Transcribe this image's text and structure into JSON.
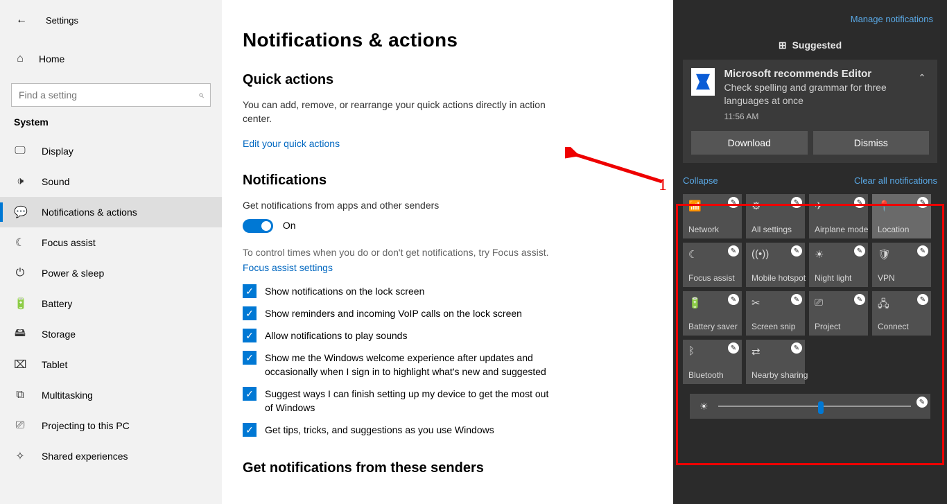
{
  "app": {
    "title": "Settings",
    "home": "Home",
    "find_placeholder": "Find a setting",
    "group": "System"
  },
  "nav": [
    {
      "icon": "🖵",
      "label": "Display"
    },
    {
      "icon": "🕩",
      "label": "Sound"
    },
    {
      "icon": "💬",
      "label": "Notifications & actions"
    },
    {
      "icon": "☾",
      "label": "Focus assist"
    },
    {
      "icon": "⏻",
      "label": "Power & sleep"
    },
    {
      "icon": "🔋",
      "label": "Battery"
    },
    {
      "icon": "🖴",
      "label": "Storage"
    },
    {
      "icon": "⌧",
      "label": "Tablet"
    },
    {
      "icon": "⧉",
      "label": "Multitasking"
    },
    {
      "icon": "⎚",
      "label": "Projecting to this PC"
    },
    {
      "icon": "✧",
      "label": "Shared experiences"
    }
  ],
  "page": {
    "title": "Notifications & actions",
    "qa_head": "Quick actions",
    "qa_desc": "You can add, remove, or rearrange your quick actions directly in action center.",
    "qa_link": "Edit your quick actions",
    "notif_head": "Notifications",
    "notif_desc": "Get notifications from apps and other senders",
    "toggle_label": "On",
    "focus_hint": "To control times when you do or don't get notifications, try Focus assist.",
    "focus_link": "Focus assist settings",
    "checks": [
      "Show notifications on the lock screen",
      "Show reminders and incoming VoIP calls on the lock screen",
      "Allow notifications to play sounds",
      "Show me the Windows welcome experience after updates and occasionally when I sign in to highlight what's new and suggested",
      "Suggest ways I can finish setting up my device to get the most out of Windows",
      "Get tips, tricks, and suggestions as you use Windows"
    ],
    "senders_head": "Get notifications from these senders"
  },
  "ac": {
    "manage": "Manage notifications",
    "suggested": "Suggested",
    "card": {
      "title": "Microsoft recommends Editor",
      "sub": "Check spelling and grammar for three languages at once",
      "time": "11:56 AM",
      "download": "Download",
      "dismiss": "Dismiss"
    },
    "collapse": "Collapse",
    "clear": "Clear all notifications",
    "tiles": [
      {
        "icon": "📶",
        "label": "Network"
      },
      {
        "icon": "⚙",
        "label": "All settings"
      },
      {
        "icon": "✈",
        "label": "Airplane mode"
      },
      {
        "icon": "📍",
        "label": "Location",
        "light": true
      },
      {
        "icon": "☾",
        "label": "Focus assist"
      },
      {
        "icon": "((•))",
        "label": "Mobile hotspot"
      },
      {
        "icon": "☀",
        "label": "Night light"
      },
      {
        "icon": "🛡",
        "label": "VPN"
      },
      {
        "icon": "🔋",
        "label": "Battery saver"
      },
      {
        "icon": "✂",
        "label": "Screen snip"
      },
      {
        "icon": "⎚",
        "label": "Project"
      },
      {
        "icon": "🖧",
        "label": "Connect"
      },
      {
        "icon": "ᛒ",
        "label": "Bluetooth"
      },
      {
        "icon": "⇄",
        "label": "Nearby sharing"
      }
    ]
  },
  "annot": {
    "num": "1"
  }
}
